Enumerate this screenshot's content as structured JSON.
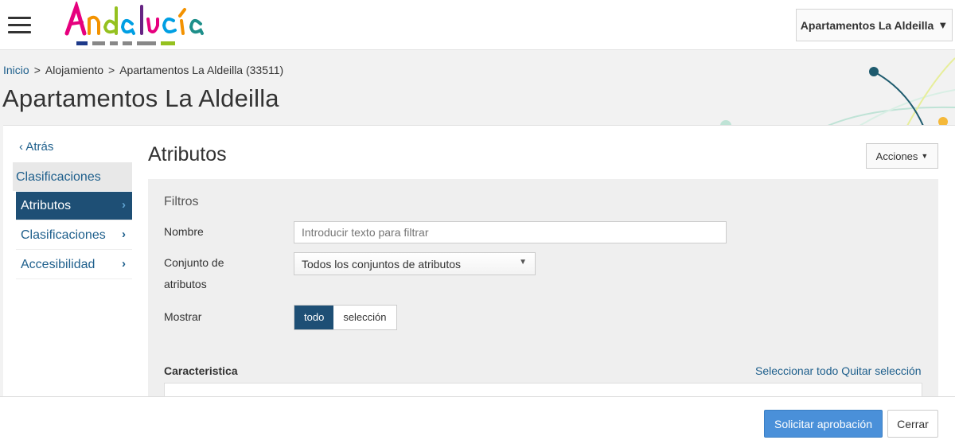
{
  "header": {
    "hotel_name": "Apartamentos La Aldeilla",
    "hotel_arrow": "▼"
  },
  "breadcrumb": {
    "items": [
      "Inicio",
      "Alojamiento",
      "Apartamentos La Aldeilla (33511)"
    ],
    "separator": ">"
  },
  "page": {
    "title": "Apartamentos La Aldeilla"
  },
  "sidebar": {
    "back": "Atrás",
    "group": "Clasificaciones",
    "items": [
      {
        "label": "Atributos",
        "active": true
      },
      {
        "label": "Clasificaciones",
        "active": false
      },
      {
        "label": "Accesibilidad",
        "active": false
      }
    ]
  },
  "section": {
    "title": "Atributos",
    "actions": "Acciones"
  },
  "filters": {
    "title": "Filtros",
    "name_label": "Nombre",
    "name_placeholder": "Introducir texto para filtrar",
    "set_label_1": "Conjunto de",
    "set_label_2": "atributos",
    "set_value": "Todos los conjuntos de atributos",
    "show_label": "Mostrar",
    "show_options": [
      "todo",
      "selección"
    ]
  },
  "characteristic": {
    "label": "Caracteristica",
    "select_all": "Seleccionar todo",
    "clear_selection": "Quitar selección"
  },
  "footer": {
    "request_approval": "Solicitar aprobación",
    "close": "Cerrar"
  },
  "colors": {
    "primary": "#4a90d9",
    "active_nav": "#1e4f75",
    "link": "#1e5f8c"
  }
}
